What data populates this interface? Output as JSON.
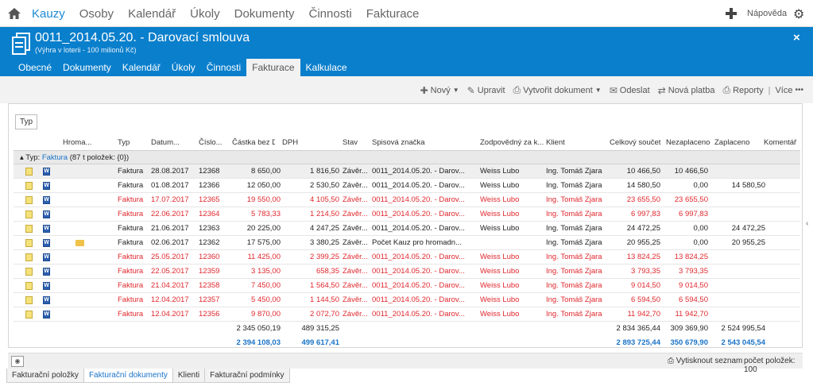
{
  "topnav": {
    "items": [
      "Kauzy",
      "Osoby",
      "Kalendář",
      "Úkoly",
      "Dokumenty",
      "Činnosti",
      "Fakturace"
    ],
    "active_index": 0,
    "help": "Nápověda",
    "icons": {
      "home": "home-icon",
      "add": "plus-icon",
      "settings": "gear-icon"
    }
  },
  "header": {
    "title": "0011_2014.05.20. - Darovací smlouva",
    "subtitle": "(Výhra v loterii - 100 milionů Kč)",
    "close": "×",
    "tabs": [
      "Obecné",
      "Dokumenty",
      "Kalendář",
      "Úkoly",
      "Činnosti",
      "Fakturace",
      "Kalkulace"
    ],
    "active_tab": 5
  },
  "toolbar": {
    "new": "Nový",
    "edit": "Upravit",
    "create_doc": "Vytvořit dokument",
    "send": "Odeslat",
    "new_payment": "Nová platba",
    "reports": "Reporty",
    "sep": "|",
    "more": "Více"
  },
  "grid": {
    "group_button": "Typ",
    "columns": [
      "Hroma...",
      "Typ",
      "Datum...",
      "Číslo...",
      "Částka bez DPH",
      "DPH",
      "Stav",
      "Spisová značka",
      "Zodpovědný za k...",
      "Klient",
      "Celkový součet",
      "Nezaplaceno",
      "Zaplaceno",
      "Komentář"
    ],
    "group": {
      "prefix": "Typ: ",
      "name": "Faktura",
      "suffix": " (87 t položek: {0})"
    },
    "rows": [
      {
        "typ": "Faktura",
        "datum": "28.08.2017",
        "cislo": "12368",
        "castka": "8 650,00",
        "dph": "1 816,50",
        "stav": "Závěr...",
        "spis": "0011_2014.05.20. - Darov...",
        "zodp": "Weiss Lubo",
        "klient": "Ing. Tomáš Zjara",
        "celkem": "10 466,50",
        "nezapl": "10 466,50",
        "zapl": "",
        "red": false,
        "sel": true,
        "folder": false
      },
      {
        "typ": "Faktura",
        "datum": "01.08.2017",
        "cislo": "12366",
        "castka": "12 050,00",
        "dph": "2 530,50",
        "stav": "Závěr...",
        "spis": "0011_2014.05.20. - Darov...",
        "zodp": "Weiss Lubo",
        "klient": "Ing. Tomáš Zjara",
        "celkem": "14 580,50",
        "nezapl": "0,00",
        "zapl": "14 580,50",
        "red": false,
        "sel": false,
        "folder": false
      },
      {
        "typ": "Faktura",
        "datum": "17.07.2017",
        "cislo": "12365",
        "castka": "19 550,00",
        "dph": "4 105,50",
        "stav": "Závěr...",
        "spis": "0011_2014.05.20. - Darov...",
        "zodp": "Weiss Lubo",
        "klient": "Ing. Tomáš Zjara",
        "celkem": "23 655,50",
        "nezapl": "23 655,50",
        "zapl": "",
        "red": true,
        "sel": false,
        "folder": false
      },
      {
        "typ": "Faktura",
        "datum": "22.06.2017",
        "cislo": "12364",
        "castka": "5 783,33",
        "dph": "1 214,50",
        "stav": "Závěr...",
        "spis": "0011_2014.05.20. - Darov...",
        "zodp": "Weiss Lubo",
        "klient": "Ing. Tomáš Zjara",
        "celkem": "6 997,83",
        "nezapl": "6 997,83",
        "zapl": "",
        "red": true,
        "sel": false,
        "folder": false
      },
      {
        "typ": "Faktura",
        "datum": "21.06.2017",
        "cislo": "12363",
        "castka": "20 225,00",
        "dph": "4 247,25",
        "stav": "Závěr...",
        "spis": "0011_2014.05.20. - Darov...",
        "zodp": "Weiss Lubo",
        "klient": "Ing. Tomáš Zjara",
        "celkem": "24 472,25",
        "nezapl": "0,00",
        "zapl": "24 472,25",
        "red": false,
        "sel": false,
        "folder": false
      },
      {
        "typ": "Faktura",
        "datum": "02.06.2017",
        "cislo": "12362",
        "castka": "17 575,00",
        "dph": "3 380,25",
        "stav": "Závěr...",
        "spis": "Počet Kauz pro hromadn...",
        "zodp": "",
        "klient": "Ing. Tomáš Zjara",
        "celkem": "20 955,25",
        "nezapl": "0,00",
        "zapl": "20 955,25",
        "red": false,
        "sel": false,
        "folder": true
      },
      {
        "typ": "Faktura",
        "datum": "25.05.2017",
        "cislo": "12360",
        "castka": "11 425,00",
        "dph": "2 399,25",
        "stav": "Závěr...",
        "spis": "0011_2014.05.20. - Darov...",
        "zodp": "Weiss Lubo",
        "klient": "Ing. Tomáš Zjara",
        "celkem": "13 824,25",
        "nezapl": "13 824,25",
        "zapl": "",
        "red": true,
        "sel": false,
        "folder": false
      },
      {
        "typ": "Faktura",
        "datum": "22.05.2017",
        "cislo": "12359",
        "castka": "3 135,00",
        "dph": "658,35",
        "stav": "Závěr...",
        "spis": "0011_2014.05.20. - Darov...",
        "zodp": "Weiss Lubo",
        "klient": "Ing. Tomáš Zjara",
        "celkem": "3 793,35",
        "nezapl": "3 793,35",
        "zapl": "",
        "red": true,
        "sel": false,
        "folder": false
      },
      {
        "typ": "Faktura",
        "datum": "21.04.2017",
        "cislo": "12358",
        "castka": "7 450,00",
        "dph": "1 564,50",
        "stav": "Závěr...",
        "spis": "0011_2014.05.20. - Darov...",
        "zodp": "Weiss Lubo",
        "klient": "Ing. Tomáš Zjara",
        "celkem": "9 014,50",
        "nezapl": "9 014,50",
        "zapl": "",
        "red": true,
        "sel": false,
        "folder": false
      },
      {
        "typ": "Faktura",
        "datum": "12.04.2017",
        "cislo": "12357",
        "castka": "5 450,00",
        "dph": "1 144,50",
        "stav": "Závěr...",
        "spis": "0011_2014.05.20. - Darov...",
        "zodp": "Weiss Lubo",
        "klient": "Ing. Tomáš Zjara",
        "celkem": "6 594,50",
        "nezapl": "6 594,50",
        "zapl": "",
        "red": true,
        "sel": false,
        "folder": false
      },
      {
        "typ": "Faktura",
        "datum": "12.04.2017",
        "cislo": "12356",
        "castka": "9 870,00",
        "dph": "2 072,70",
        "stav": "Závěr...",
        "spis": "0011_2014.05.20. - Darov...",
        "zodp": "Weiss Lubo",
        "klient": "Ing. Tomáš Zjara",
        "celkem": "11 942,70",
        "nezapl": "11 942,70",
        "zapl": "",
        "red": true,
        "sel": false,
        "folder": false
      }
    ],
    "totals_group": {
      "castka": "2 345 050,19",
      "dph": "489 315,25",
      "celkem": "2 834 365,44",
      "nezapl": "309 369,90",
      "zapl": "2 524 995,54"
    },
    "totals_all": {
      "castka": "2 394 108,03",
      "dph": "499 617,41",
      "celkem": "2 893 725,44",
      "nezapl": "350 679,90",
      "zapl": "2 543 045,54"
    }
  },
  "footer": {
    "print": "Vytisknout seznam",
    "count": "počet položek: 100",
    "tabs": [
      "Fakturační položky",
      "Fakturační dokumenty",
      "Klienti",
      "Fakturační podmínky"
    ],
    "active_tab": 1
  }
}
